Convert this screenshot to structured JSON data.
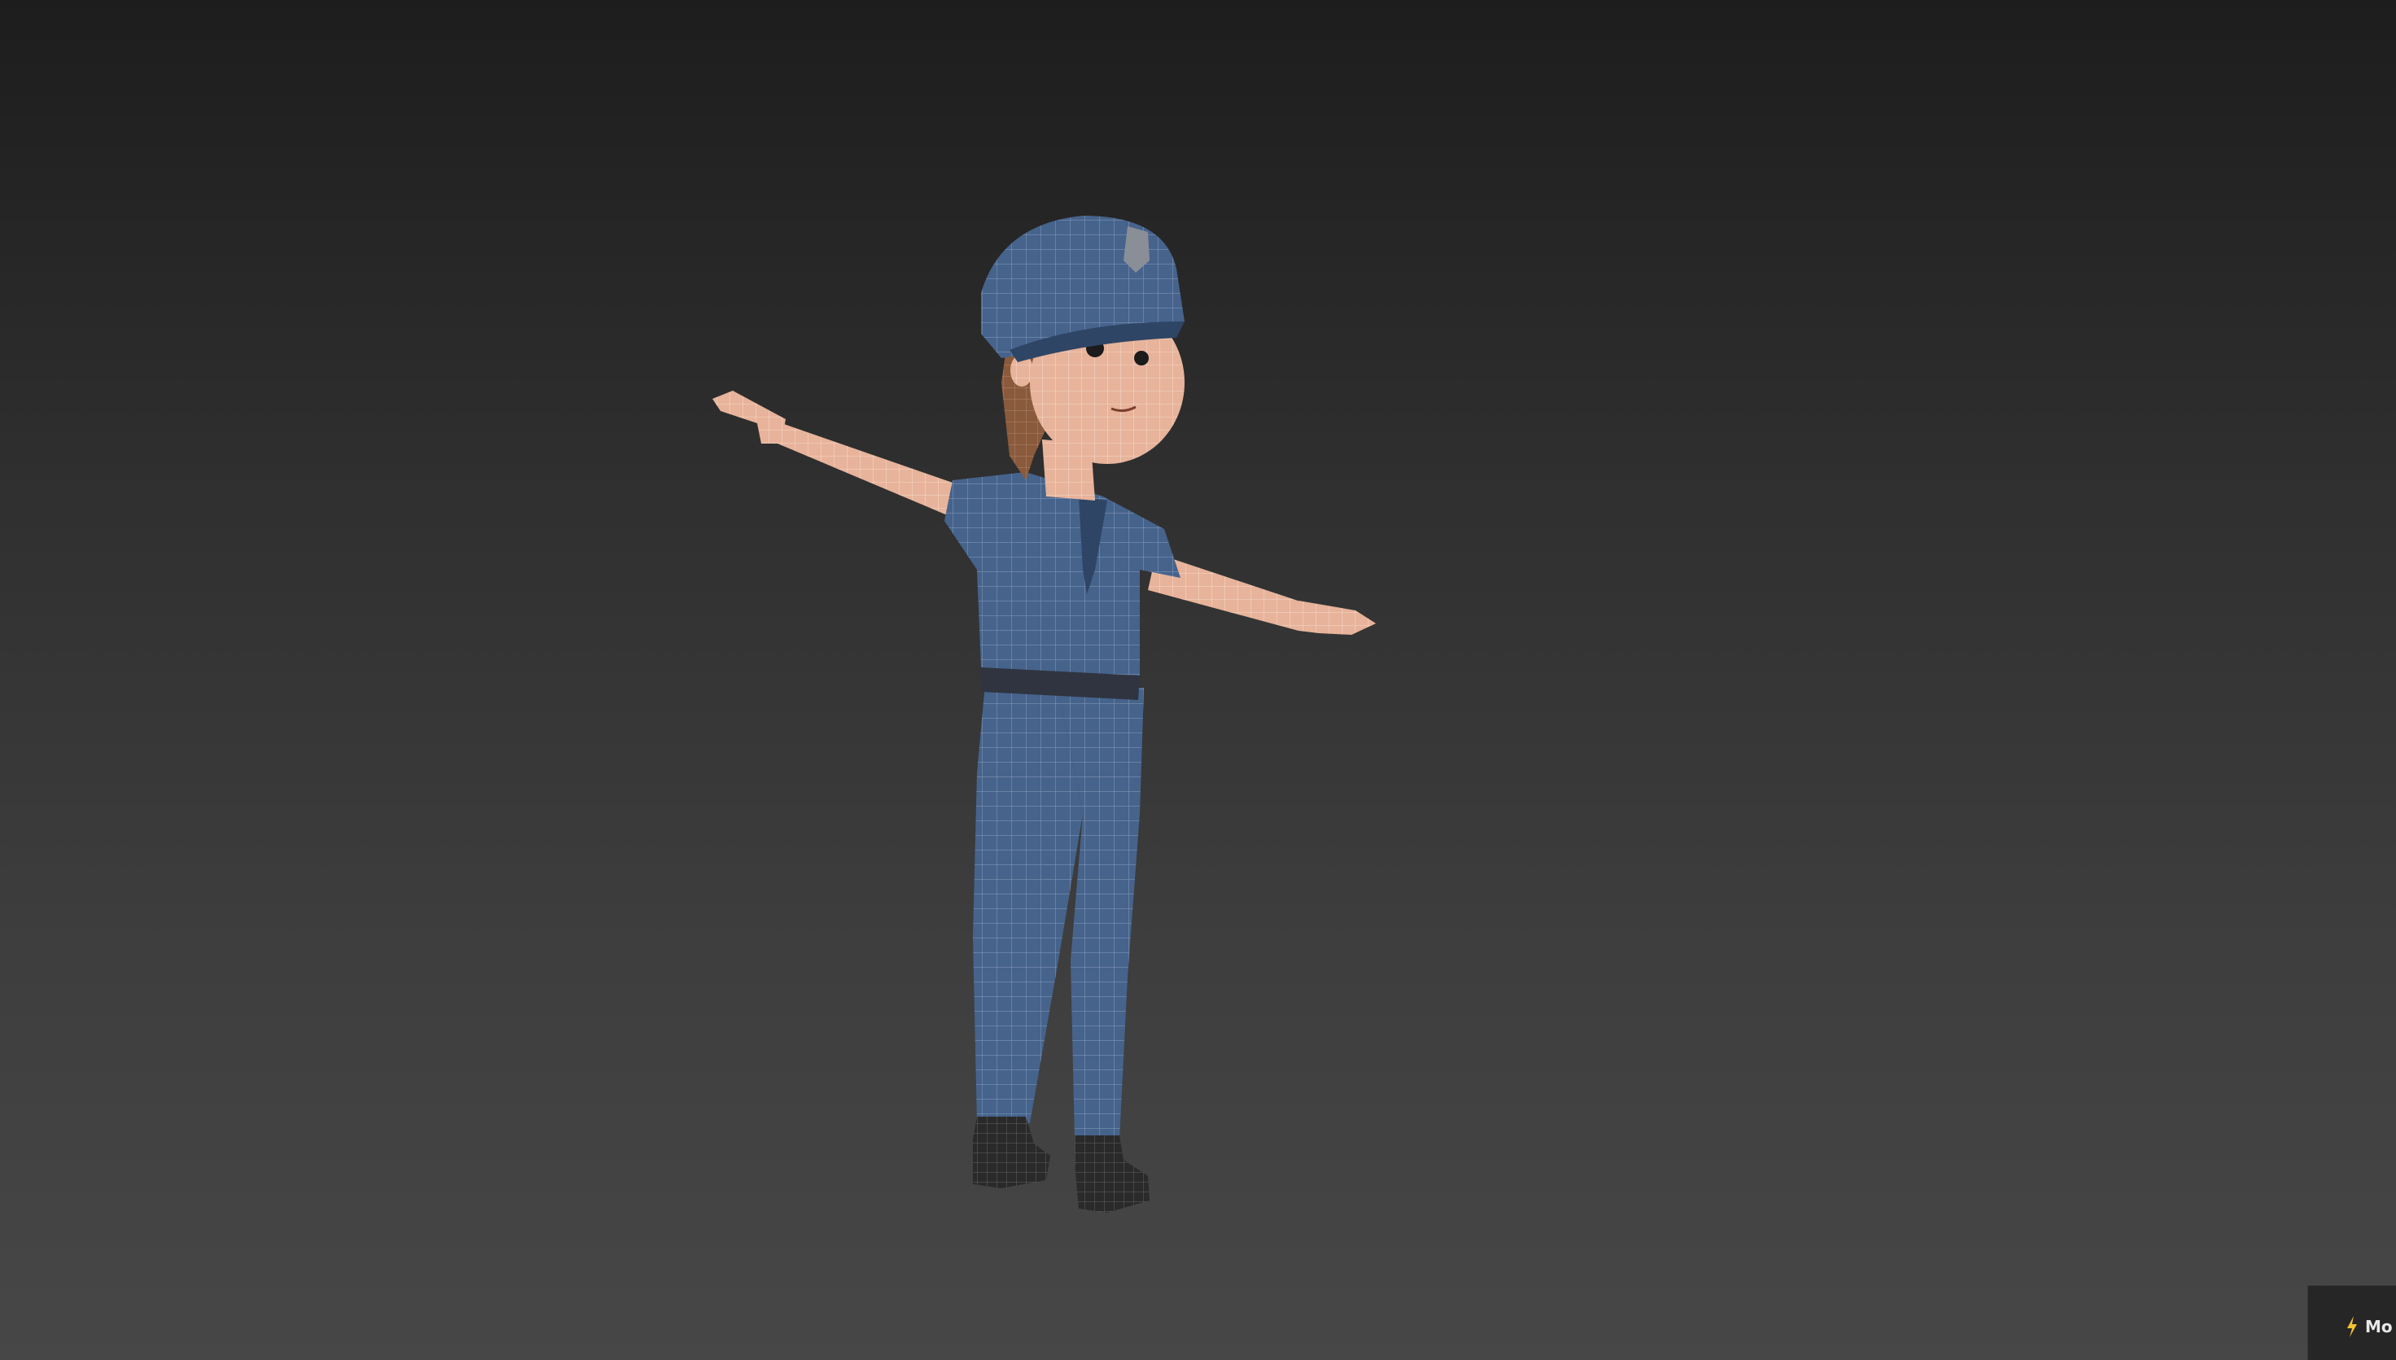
{
  "viewport": {
    "background_top": "#1d1d1d",
    "background_bottom": "#474747"
  },
  "model": {
    "colors": {
      "uniform": "#46638c",
      "uniform_dark": "#2f4565",
      "skin": "#e7b39a",
      "hair": "#8a5a3c",
      "boots": "#2a2a2a",
      "wire": "#c9d3e3"
    }
  },
  "corner_widget": {
    "label": "Mo",
    "icon": "lightning-icon",
    "accent": "#f2c230"
  }
}
